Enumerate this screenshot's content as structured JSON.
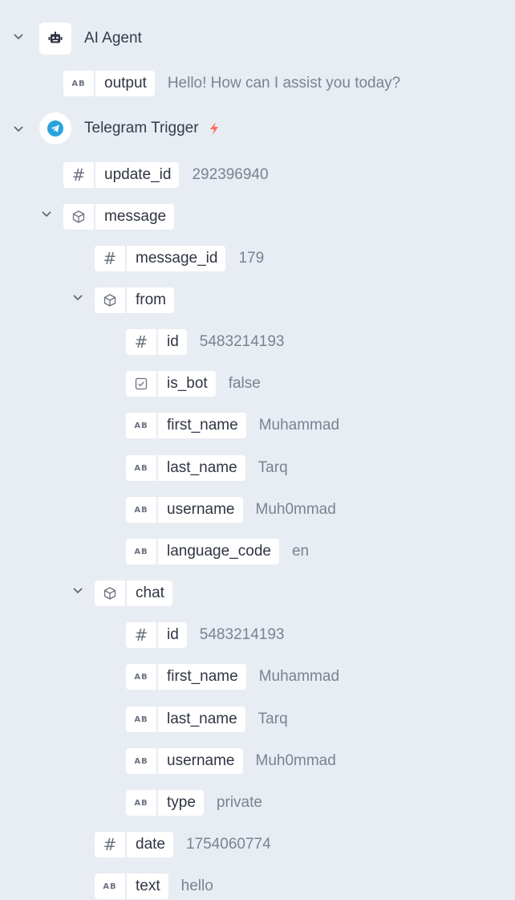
{
  "nodes": {
    "ai_agent": {
      "label": "AI Agent",
      "icon": "robot-icon",
      "fields": {
        "output": {
          "name": "output",
          "type": "string",
          "value": "Hello! How can I assist you today?"
        }
      }
    },
    "telegram_trigger": {
      "label": "Telegram Trigger",
      "icon": "telegram-icon",
      "badge_icon": "lightning-bolt-icon",
      "fields": {
        "update_id": {
          "name": "update_id",
          "type": "number",
          "value": "292396940"
        },
        "message": {
          "name": "message",
          "type": "object",
          "fields": {
            "message_id": {
              "name": "message_id",
              "type": "number",
              "value": "179"
            },
            "from": {
              "name": "from",
              "type": "object",
              "fields": {
                "id": {
                  "name": "id",
                  "type": "number",
                  "value": "5483214193"
                },
                "is_bot": {
                  "name": "is_bot",
                  "type": "boolean",
                  "value": "false"
                },
                "first_name": {
                  "name": "first_name",
                  "type": "string",
                  "value": "Muhammad"
                },
                "last_name": {
                  "name": "last_name",
                  "type": "string",
                  "value": "Tarq"
                },
                "username": {
                  "name": "username",
                  "type": "string",
                  "value": "Muh0mmad"
                },
                "language_code": {
                  "name": "language_code",
                  "type": "string",
                  "value": "en"
                }
              }
            },
            "chat": {
              "name": "chat",
              "type": "object",
              "fields": {
                "id": {
                  "name": "id",
                  "type": "number",
                  "value": "5483214193"
                },
                "first_name": {
                  "name": "first_name",
                  "type": "string",
                  "value": "Muhammad"
                },
                "last_name": {
                  "name": "last_name",
                  "type": "string",
                  "value": "Tarq"
                },
                "username": {
                  "name": "username",
                  "type": "string",
                  "value": "Muh0mmad"
                },
                "type": {
                  "name": "type",
                  "type": "string",
                  "value": "private"
                }
              }
            },
            "date": {
              "name": "date",
              "type": "number",
              "value": "1754060774"
            },
            "text": {
              "name": "text",
              "type": "string",
              "value": "hello"
            }
          }
        }
      }
    }
  },
  "type_badges": {
    "string": "AB",
    "number": "#"
  },
  "colors": {
    "background": "#e8ecf3",
    "telegram_blue": "#2aa3dc",
    "bolt": "#ff6b57"
  }
}
